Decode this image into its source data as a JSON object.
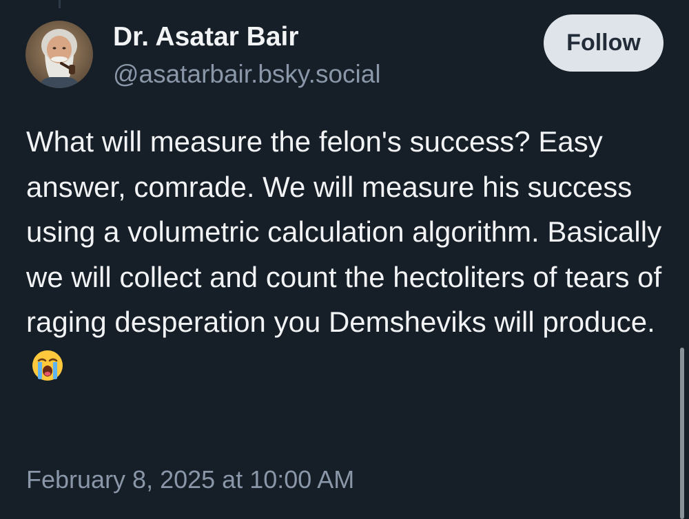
{
  "post": {
    "author": {
      "display_name": "Dr. Asatar Bair",
      "handle": "@asatarbair.bsky.social"
    },
    "follow_label": "Follow",
    "text": "What will measure the felon's success? Easy answer, comrade. We will measure his success using a volumetric calculation algorithm. Basically we will collect and count the hectoliters of tears of raging  desperation you Demsheviks will produce.",
    "emoji": "loudly-crying-face-icon",
    "timestamp": "February 8, 2025 at 10:00 AM"
  },
  "colors": {
    "background": "#161e27",
    "text_primary": "#f1f3f5",
    "text_secondary": "#8a97a8",
    "follow_button_bg": "#dfe4ea",
    "follow_button_text": "#212c38"
  }
}
